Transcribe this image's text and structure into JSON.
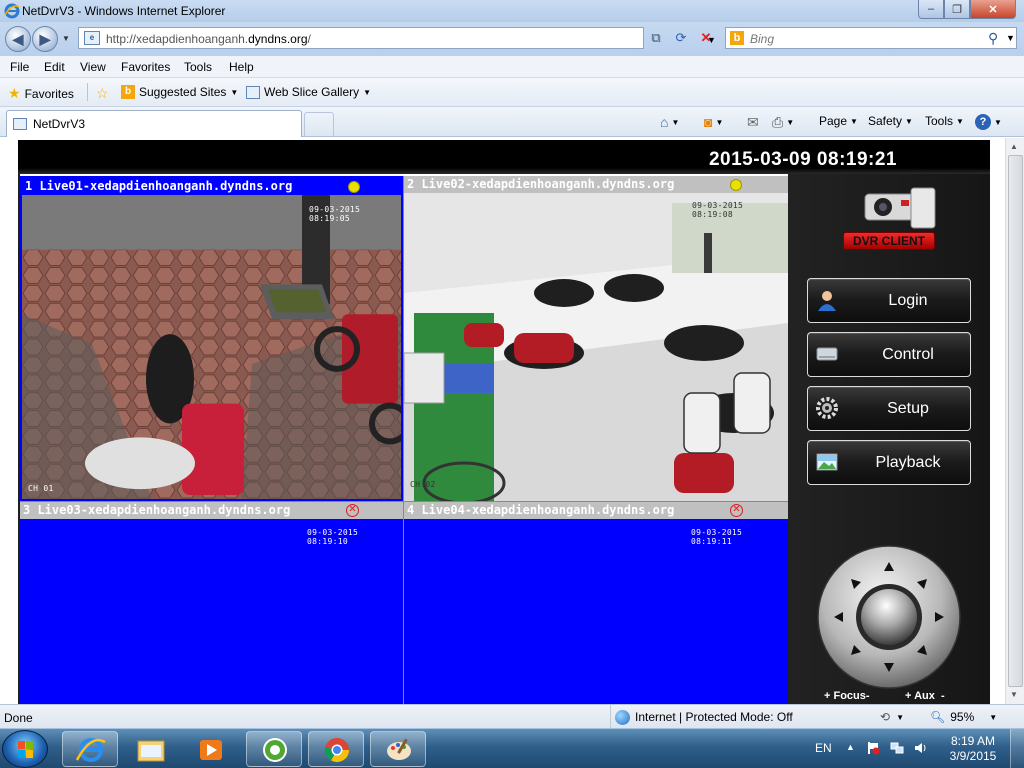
{
  "window": {
    "title": "NetDvrV3 - Windows Internet Explorer",
    "min_symbol": "–",
    "max_symbol": "❐",
    "close_symbol": "✕"
  },
  "address": {
    "url_prefix": "http://xedapdienhoanganh.",
    "url_domain": "dyndns.org",
    "url_suffix": "/",
    "search_placeholder": "Bing"
  },
  "menu": [
    "File",
    "Edit",
    "View",
    "Favorites",
    "Tools",
    "Help"
  ],
  "favorites_bar": {
    "favorites": "Favorites",
    "suggested": "Suggested Sites",
    "webslice": "Web Slice Gallery"
  },
  "tab": {
    "title": "NetDvrV3"
  },
  "command_bar": {
    "page": "Page",
    "safety": "Safety",
    "tools": "Tools"
  },
  "dvr": {
    "datetime": "2015-03-09 08:19:21",
    "logo_text": "DVR CLIENT",
    "cameras": [
      {
        "header": "1 Live01-xedapdienhoanganh.dyndns.org",
        "status": "online",
        "osd_time": "09-03-2015 08:19:05",
        "osd_channel": "CH 01"
      },
      {
        "header": "2 Live02-xedapdienhoanganh.dyndns.org",
        "status": "online",
        "osd_time": "09-03-2015 08:19:08",
        "osd_channel": "CH 02"
      },
      {
        "header": "3 Live03-xedapdienhoanganh.dyndns.org",
        "status": "offline",
        "osd_time": "09-03-2015 08:19:10",
        "osd_channel": ""
      },
      {
        "header": "4 Live04-xedapdienhoanganh.dyndns.org",
        "status": "offline",
        "osd_time": "09-03-2015 08:19:11",
        "osd_channel": ""
      }
    ],
    "buttons": {
      "login": "Login",
      "control": "Control",
      "setup": "Setup",
      "playback": "Playback"
    },
    "ptz": {
      "focus": "+ Focus-",
      "aux": "+ Aux  -"
    }
  },
  "statusbar": {
    "status": "Done",
    "zone": "Internet | Protected Mode: Off",
    "zoom": "95%"
  },
  "taskbar": {
    "language": "EN",
    "time": "8:19 AM",
    "date": "3/9/2015"
  },
  "colors": {
    "camera_blank": "#0000ff",
    "active_header": "#0000ff",
    "idle_header": "#c0c0c0",
    "status_online": "#e8e000",
    "status_offline": "#d62020",
    "logo_red": "#e01010"
  }
}
